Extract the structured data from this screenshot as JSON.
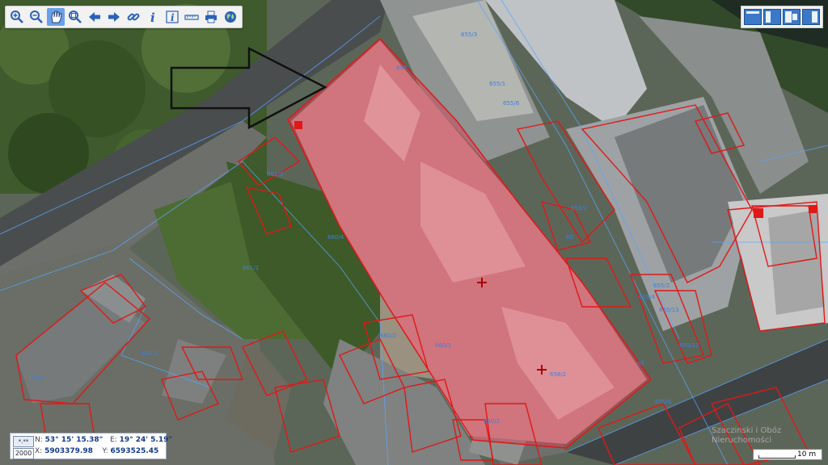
{
  "toolbar": {
    "tools": [
      {
        "name": "zoom-in-icon"
      },
      {
        "name": "zoom-out-icon"
      },
      {
        "name": "pan-hand-icon",
        "active": true
      },
      {
        "name": "zoom-box-icon"
      },
      {
        "name": "arrow-left-icon"
      },
      {
        "name": "arrow-right-icon"
      },
      {
        "name": "link-icon"
      },
      {
        "name": "info-icon"
      },
      {
        "name": "info-doc-icon"
      },
      {
        "name": "ruler-icon"
      },
      {
        "name": "print-icon"
      },
      {
        "name": "globe-icon"
      }
    ]
  },
  "window_tools": {
    "buttons": [
      {
        "name": "layout-full-icon"
      },
      {
        "name": "layout-left-panel-icon"
      },
      {
        "name": "layout-split-icon"
      },
      {
        "name": "layout-right-panel-icon"
      }
    ]
  },
  "parcel_labels": [
    "655/3",
    "655/1",
    "655/8",
    "659",
    "661/3",
    "660/4",
    "661/1",
    "660/2",
    "660/1",
    "658/2",
    "655/2",
    "655/4",
    "655/13",
    "655/12",
    "664",
    "660/3",
    "650/2",
    "655/6",
    "60",
    "n3",
    "653/2"
  ],
  "coordinates": {
    "epsg_button": "*.**",
    "epsg": "2000",
    "n_label": "N:",
    "n_value": "53° 15' 15.38\"",
    "e_label": "E:",
    "e_value": "19° 24' 5.19\"",
    "x_label": "X:",
    "x_value": "5903379.98",
    "y_label": "Y:",
    "y_value": "6593525.45"
  },
  "scale": {
    "label": "10 m"
  },
  "watermark": {
    "line1": "Szaczinski i Obóz",
    "line2": "Nieruchomości"
  },
  "colors": {
    "parcel": "#e01818",
    "highlight": "rgba(220,60,80,0.45)",
    "boundary": "#58a6ff"
  }
}
